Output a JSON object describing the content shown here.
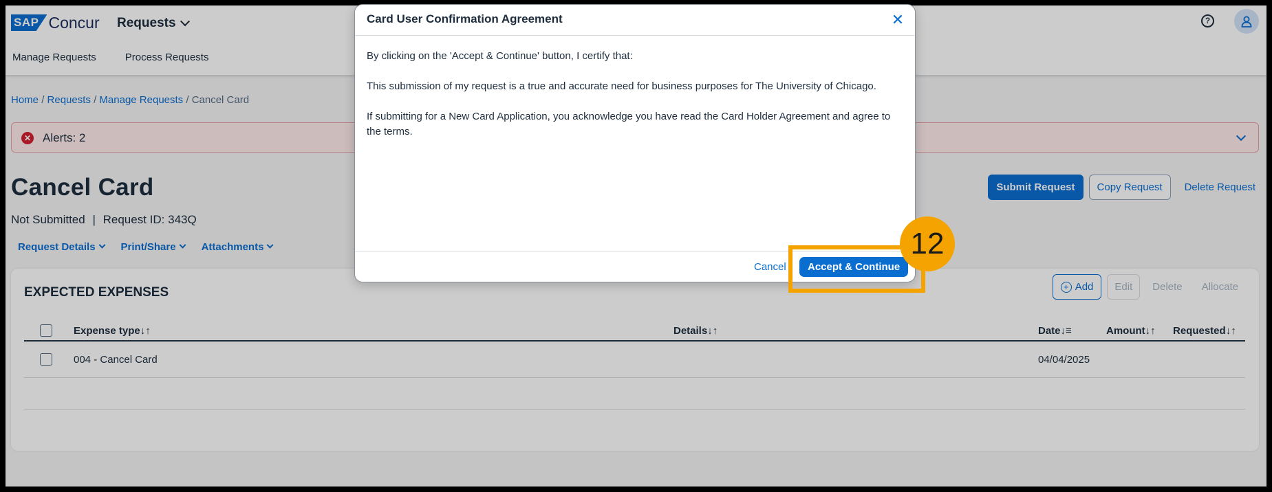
{
  "header": {
    "logo_sap": "SAP",
    "logo_concur": "Concur",
    "module": "Requests",
    "help": "?"
  },
  "subnav": [
    "Manage Requests",
    "Process Requests"
  ],
  "breadcrumb": {
    "items": [
      "Home",
      "Requests",
      "Manage Requests"
    ],
    "current": "Cancel Card",
    "separator": "/"
  },
  "alert": {
    "text": "Alerts: 2",
    "icon": "✕"
  },
  "page": {
    "title": "Cancel Card",
    "status": "Not Submitted",
    "separator": "|",
    "request_id": "Request ID: 343Q"
  },
  "actions": {
    "submit": "Submit Request",
    "copy": "Copy Request",
    "delete": "Delete Request"
  },
  "tabs": [
    "Request Details",
    "Print/Share",
    "Attachments"
  ],
  "expenses": {
    "title": "EXPECTED EXPENSES",
    "add": "Add",
    "edit": "Edit",
    "delete": "Delete",
    "allocate": "Allocate",
    "columns": {
      "type": "Expense type",
      "details": "Details",
      "date": "Date",
      "amount": "Amount",
      "requested": "Requested"
    },
    "sort_icons": {
      "both": "↓↑",
      "date": "↓≡"
    },
    "rows": [
      {
        "type": "004 - Cancel Card",
        "details": "",
        "date": "04/04/2025",
        "amount": "",
        "requested": ""
      }
    ]
  },
  "modal": {
    "title": "Card User Confirmation Agreement",
    "close": "✕",
    "paragraphs": [
      "By clicking on the 'Accept & Continue' button, I certify that:",
      "This submission of my request is a true and accurate need for business purposes for The University of Chicago.",
      "If submitting for a New Card Application, you acknowledge you have read the Card Holder Agreement and agree to the terms."
    ],
    "cancel": "Cancel",
    "accept": "Accept & Continue"
  },
  "annotation": {
    "step": "12",
    "color": "#f4a300"
  },
  "colors": {
    "brand": "#0a6ed1",
    "alert_bg": "#ffebeb",
    "alert_icon": "#d32030"
  }
}
